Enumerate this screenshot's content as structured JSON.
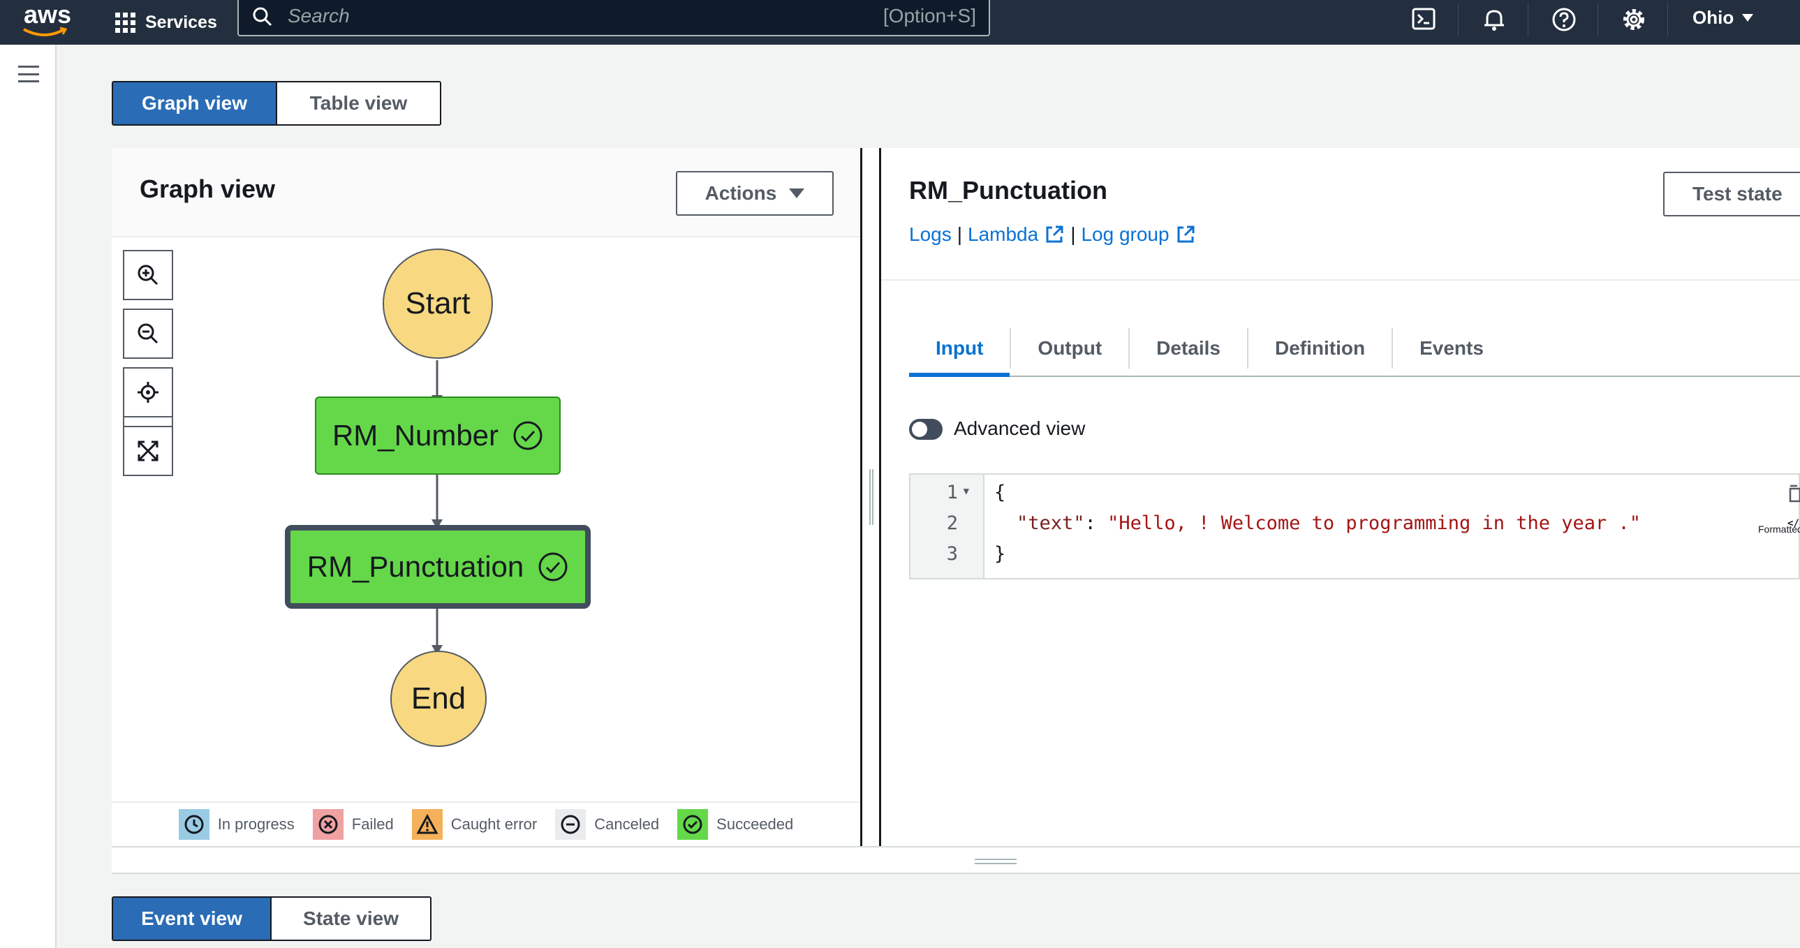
{
  "topnav": {
    "logo_text": "aws",
    "services_label": "Services",
    "search_placeholder": "Search",
    "search_shortcut": "[Option+S]",
    "region": "Ohio"
  },
  "view_toggle": {
    "graph": "Graph view",
    "table": "Table view"
  },
  "graph_panel": {
    "title": "Graph view",
    "actions_label": "Actions",
    "nodes": {
      "start": "Start",
      "step1": "RM_Number",
      "step2": "RM_Punctuation",
      "end": "End"
    },
    "legend": [
      "In progress",
      "Failed",
      "Caught error",
      "Canceled",
      "Succeeded"
    ]
  },
  "detail_panel": {
    "title": "RM_Punctuation",
    "links": {
      "logs": "Logs",
      "lambda": "Lambda",
      "log_group": "Log group"
    },
    "separator": "|",
    "test_state_label": "Test state",
    "tabs": [
      "Input",
      "Output",
      "Details",
      "Definition",
      "Events"
    ],
    "advanced_view_label": "Advanced view",
    "code": {
      "line_numbers": [
        "1",
        "2",
        "3"
      ],
      "open_brace": "{",
      "key": "\"text\"",
      "colon": ": ",
      "value": "\"Hello, ! Welcome to programming in the year .\"",
      "close_brace": "}",
      "formatted_label": "Formatted"
    }
  },
  "bottom_toggle": {
    "event": "Event view",
    "state": "State view"
  },
  "colors": {
    "nav": "#232f3e",
    "accent": "#0972d3",
    "selected_button": "#2a6cb5",
    "node_success": "#65d84a",
    "node_terminal": "#f8d880"
  }
}
